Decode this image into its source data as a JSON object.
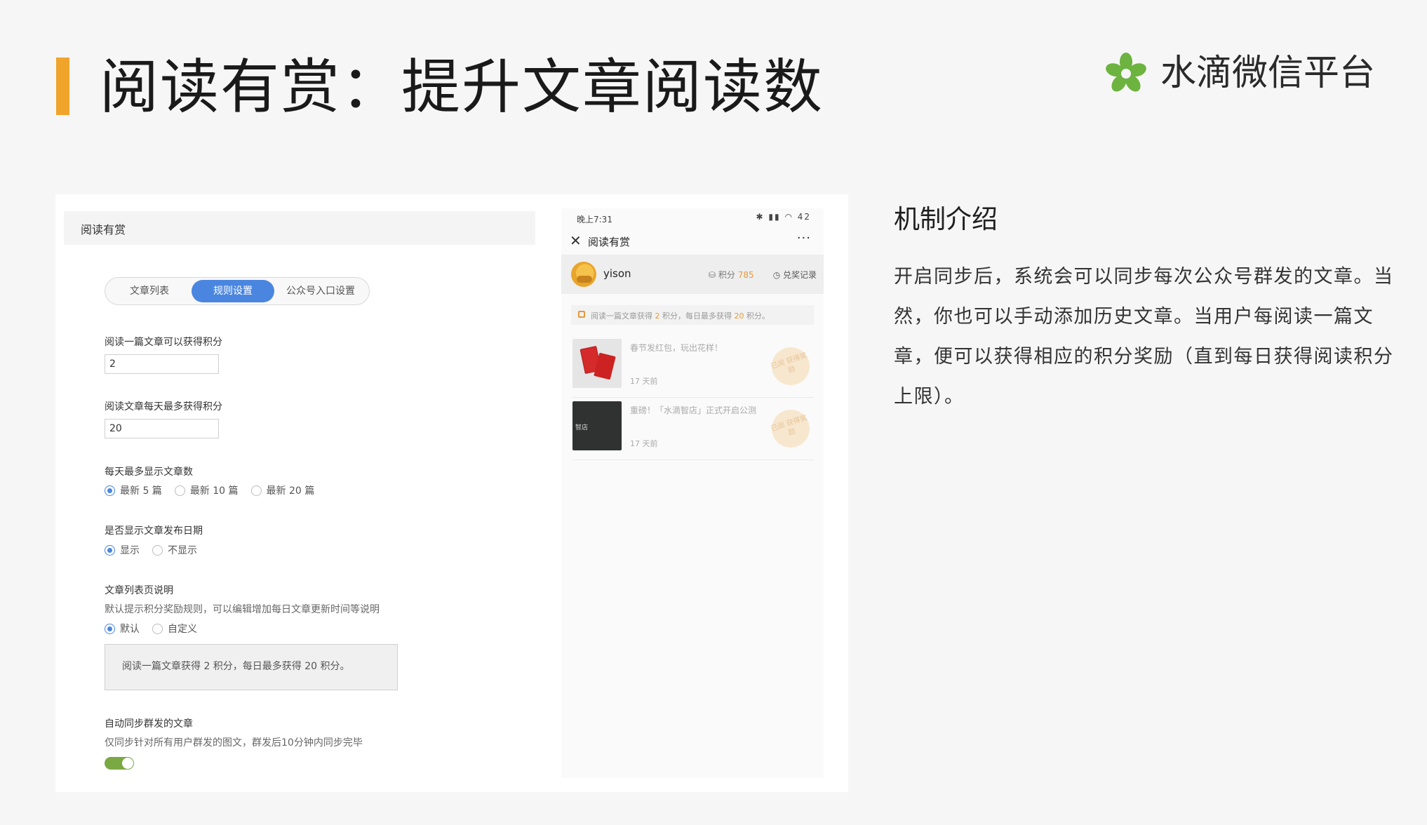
{
  "slide": {
    "title": "阅读有赏：提升文章阅读数",
    "brand_name": "水滴微信平台",
    "accent_color": "#f0a42c",
    "brand_color": "#6cb33f"
  },
  "admin": {
    "header_title": "阅读有赏",
    "tabs": [
      {
        "label": "文章列表",
        "active": false
      },
      {
        "label": "规则设置",
        "active": true
      },
      {
        "label": "公众号入口设置",
        "active": false
      }
    ],
    "per_article_label": "阅读一篇文章可以获得积分",
    "per_article_value": "2",
    "daily_max_label": "阅读文章每天最多获得积分",
    "daily_max_value": "20",
    "show_count_label": "每天最多显示文章数",
    "show_count_options": [
      "最新 5 篇",
      "最新 10 篇",
      "最新 20 篇"
    ],
    "show_count_selected": 0,
    "show_date_label": "是否显示文章发布日期",
    "show_date_options": [
      "显示",
      "不显示"
    ],
    "show_date_selected": 0,
    "list_desc_label": "文章列表页说明",
    "list_desc_help": "默认提示积分奖励规则，可以编辑增加每日文章更新时间等说明",
    "list_desc_options": [
      "默认",
      "自定义"
    ],
    "list_desc_selected": 0,
    "list_desc_text": "阅读一篇文章获得 2 积分，每日最多获得 20 积分。",
    "auto_sync_label": "自动同步群发的文章",
    "auto_sync_help": "仅同步针对所有用户群发的图文，群发后10分钟内同步完毕",
    "auto_sync_enabled": true,
    "primary_color": "#4a86e0",
    "toggle_color": "#7aa843"
  },
  "phone": {
    "status_time": "晚上7:31",
    "status_icons": "✱ ▮▮ ◠ 42",
    "nav_title": "阅读有赏",
    "close_glyph": "✕",
    "more_glyph": "···",
    "username": "yison",
    "points_label": "积分",
    "points_value": "785",
    "redeem_label": "兑奖记录",
    "notice_prefix": "阅读一篇文章获得 ",
    "notice_points": "2",
    "notice_mid": " 积分，每日最多获得 ",
    "notice_max": "20",
    "notice_suffix": " 积分。",
    "articles": [
      {
        "title": "春节发红包，玩出花样！",
        "time": "17 天前",
        "stamp": "已阅 获得奖励",
        "thumb": "red"
      },
      {
        "title": "重磅！「水滴智店」正式开启公测",
        "time": "17 天前",
        "stamp": "已阅 获得奖励",
        "thumb": "dark",
        "thumb_label": "智店"
      }
    ],
    "accent_color": "#e59a3a"
  },
  "intro": {
    "heading": "机制介绍",
    "body": "开启同步后，系统会可以同步每次公众号群发的文章。当然，你也可以手动添加历史文章。当用户每阅读一篇文章，便可以获得相应的积分奖励（直到每日获得阅读积分上限）。"
  }
}
